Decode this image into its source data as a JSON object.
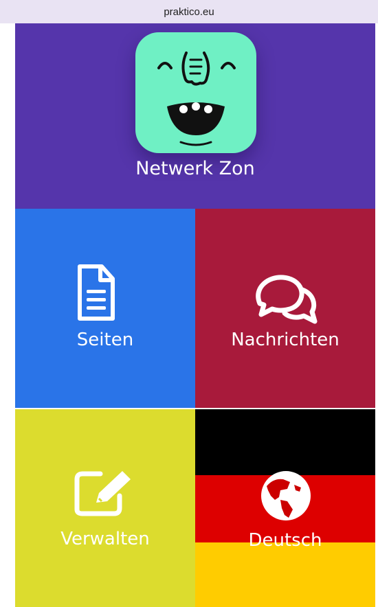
{
  "browser": {
    "url": "praktico.eu"
  },
  "app": {
    "title": "Netwerk Zon",
    "logo_icon": "monster-face-icon"
  },
  "tiles": {
    "pages": {
      "label": "Seiten",
      "icon": "document-icon",
      "color": "#2a74e8"
    },
    "messages": {
      "label": "Nachrichten",
      "icon": "chat-bubbles-icon",
      "color": "#a81a3b"
    },
    "admin": {
      "label": "Verwalten",
      "icon": "edit-icon",
      "color": "#dcdc2e"
    },
    "language": {
      "label": "Deutsch",
      "icon": "globe-icon",
      "flag_colors": [
        "#000000",
        "#dd0000",
        "#ffcc00"
      ]
    }
  },
  "colors": {
    "header": "#5535ab",
    "logo_bg": "#6ff0c4"
  }
}
